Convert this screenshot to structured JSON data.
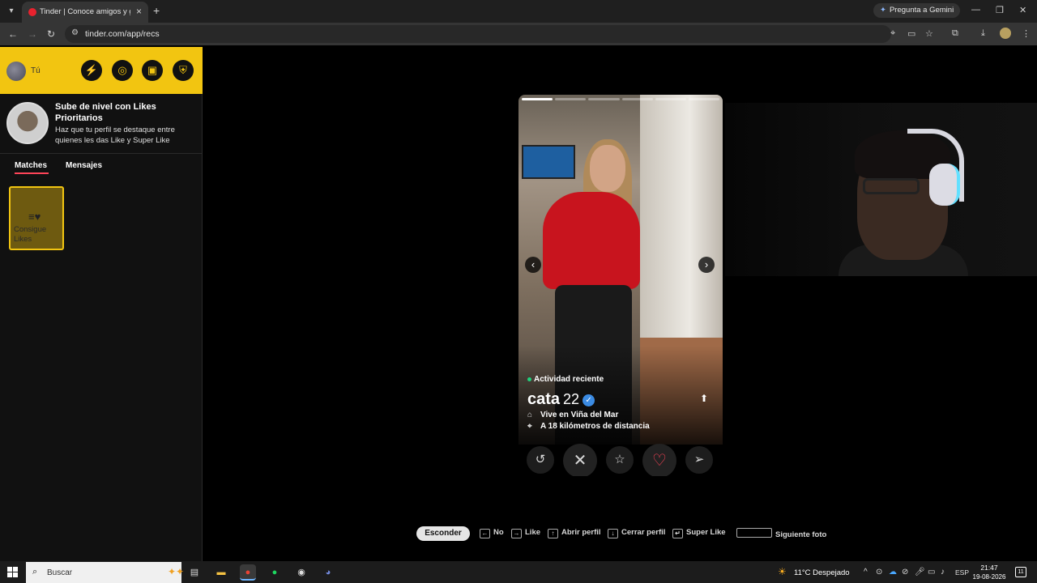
{
  "browser": {
    "tab_title": "Tinder | Conoce amigos y gente",
    "gemini_label": "Pregunta a Gemini",
    "url": "tinder.com/app/recs"
  },
  "sidebar": {
    "me_label": "Tú",
    "promo": {
      "title": "Sube de nivel con Likes Prioritarios",
      "body": "Haz que tu perfil se destaque entre quienes les das Like y Super Like"
    },
    "tabs": [
      {
        "label": "Matches",
        "active": true
      },
      {
        "label": "Mensajes",
        "active": false
      }
    ],
    "likes_card_label": "Consigue Likes"
  },
  "profile": {
    "activity": "Actividad reciente",
    "name": "cata",
    "age": "22",
    "lives_in": "Vive en Viña del Mar",
    "distance": "A 18 kilómetros de distancia",
    "photo_count": 6,
    "active_photo": 1
  },
  "shortcuts": {
    "hide_label": "Esconder",
    "items": [
      {
        "key": "←",
        "label": "No"
      },
      {
        "key": "→",
        "label": "Like"
      },
      {
        "key": "↑",
        "label": "Abrir perfil"
      },
      {
        "key": "↓",
        "label": "Cerrar perfil"
      },
      {
        "key": "↵",
        "label": "Super Like"
      },
      {
        "key": "",
        "label": "Siguiente foto"
      }
    ]
  },
  "taskbar": {
    "search_placeholder": "Buscar",
    "weather": "11°C  Despejado",
    "language": "ESP",
    "time": "21:47",
    "date": "19-08-2026",
    "notifications": "11"
  },
  "colors": {
    "tinder_yellow": "#f2c511",
    "like_red": "#ff4458",
    "verified_blue": "#3b8be3",
    "online_green": "#21d07c"
  }
}
